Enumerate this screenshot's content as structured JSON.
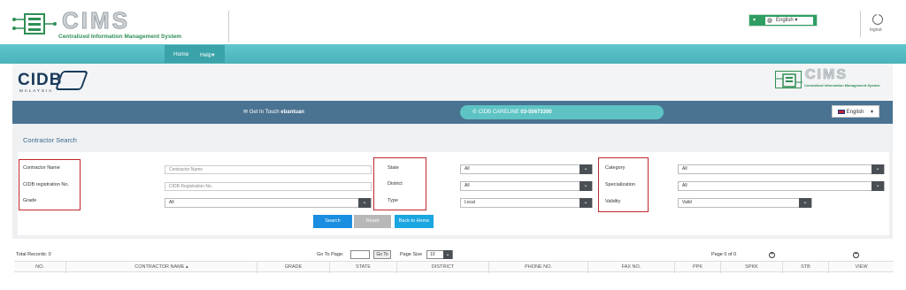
{
  "header": {
    "logo_text": "CIMS",
    "logo_subtitle": "Centralized Information Management System",
    "language_label": "English",
    "logout_label": "logout"
  },
  "nav": {
    "items": [
      {
        "label": "Home"
      },
      {
        "label": "Help"
      }
    ]
  },
  "banner": {
    "cidb_logo_text": "CIDB",
    "cidb_subtext": "MALAYSIA",
    "cims_logo_text": "CIMS",
    "cims_subtitle": "Centralized Information Management System"
  },
  "contact": {
    "get_in_touch_prefix": "Get In Touch",
    "get_in_touch_user": "ebantuan",
    "careline_prefix": "CIDB CARELINE",
    "careline_number": "03-55673300",
    "language_label": "English"
  },
  "search": {
    "title": "Contractor Search",
    "fields": {
      "contractor_name_label": "Contractor Name",
      "contractor_name_placeholder": "Contractor Name",
      "cidb_reg_label": "CIDB registration No.",
      "cidb_reg_placeholder": "CIDB Registration No.",
      "grade_label": "Grade",
      "grade_value": "All",
      "state_label": "State",
      "state_value": "All",
      "district_label": "District",
      "district_value": "All",
      "type_label": "Type",
      "type_value": "Local",
      "category_label": "Category",
      "category_value": "All",
      "specialization_label": "Specialization",
      "specialization_value": "All",
      "validity_label": "Validity",
      "validity_value": "Valid"
    },
    "buttons": {
      "search": "Search",
      "reset": "Reset",
      "back_home": "Back to Home"
    },
    "colors": {
      "search_btn": "#1a8ee0",
      "reset_btn": "#b0b0b0",
      "back_btn": "#1aa6e0",
      "highlight": "#c0272d"
    }
  },
  "results": {
    "total_records": "Total Records: 0",
    "go_to_page_label": "Go To Page:",
    "go_to_button": "Go To",
    "page_size_label": "Page Size",
    "page_size_value": "10",
    "page_info": "Page 0 of 0",
    "columns": [
      "NO.",
      "CONTRACTOR NAME",
      "GRADE",
      "STATE",
      "DISTRICT",
      "PHONE NO.",
      "FAX NO.",
      "PPK",
      "SPKK",
      "STB",
      "VIEW"
    ]
  }
}
